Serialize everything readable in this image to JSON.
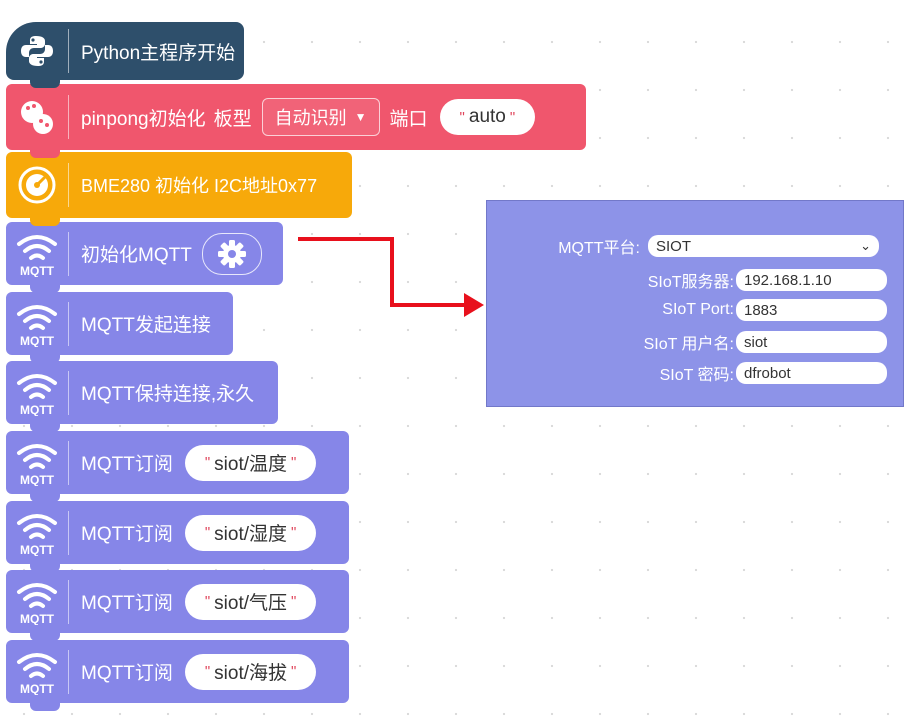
{
  "blocks": {
    "start": {
      "label": "Python主程序开始"
    },
    "pinpong": {
      "label": "pinpong初始化",
      "board_label": "板型",
      "board_value": "自动识别",
      "port_label": "端口",
      "port_value": "auto"
    },
    "bme": {
      "label": "BME280 初始化 I2C地址0x77"
    },
    "mqtt_init": {
      "label": "初始化MQTT",
      "icon_text": "MQTT"
    },
    "mqtt_connect": {
      "label": "MQTT发起连接",
      "icon_text": "MQTT"
    },
    "mqtt_keep": {
      "label": "MQTT保持连接,永久",
      "icon_text": "MQTT"
    },
    "subscribes": [
      {
        "label": "MQTT订阅",
        "topic": "siot/温度",
        "icon_text": "MQTT"
      },
      {
        "label": "MQTT订阅",
        "topic": "siot/湿度",
        "icon_text": "MQTT"
      },
      {
        "label": "MQTT订阅",
        "topic": "siot/气压",
        "icon_text": "MQTT"
      },
      {
        "label": "MQTT订阅",
        "topic": "siot/海拔",
        "icon_text": "MQTT"
      }
    ]
  },
  "panel": {
    "platform_label": "MQTT平台:",
    "platform_value": "SIOT",
    "server_label": "SIoT服务器:",
    "server_value": "192.168.1.10",
    "port_label": "SIoT Port:",
    "port_value": "1883",
    "user_label": "SIoT 用户名:",
    "user_value": "siot",
    "password_label": "SIoT 密码:",
    "password_value": "dfrobot"
  },
  "colors": {
    "python": "#2e4f6b",
    "pinpong": "#f0566d",
    "bme": "#f7a90a",
    "mqtt": "#8686e8",
    "arrow": "#e8101c",
    "panel": "#8d93e8"
  }
}
